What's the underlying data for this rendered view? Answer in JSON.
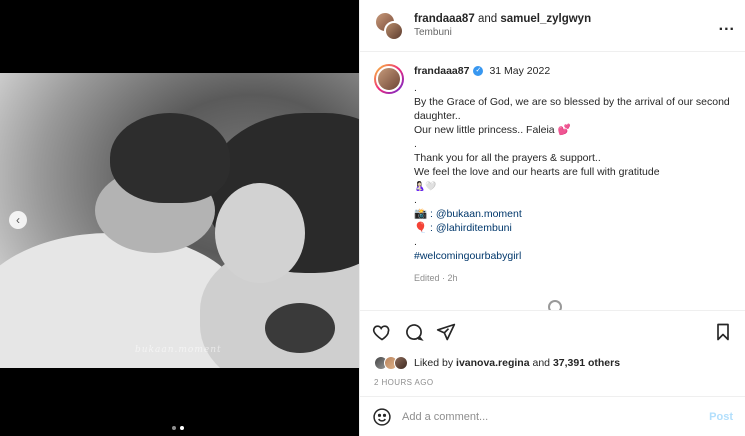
{
  "header": {
    "user1": "frandaaa87",
    "joiner": "and",
    "user2": "samuel_zylgwyn",
    "location": "Tembuni",
    "more_label": "..."
  },
  "media": {
    "watermark": "bukaan.moment",
    "prev_label": "‹",
    "slide_count": 2,
    "active_slide": 2
  },
  "caption": {
    "username": "frandaaa87",
    "date": "31 May 2022",
    "lines": [
      ".",
      "By the Grace of God, we are so blessed by the arrival of our second daughter..",
      "Our new little princess.. Faleia 💕",
      ".",
      "Thank you for all the prayers & support..",
      "We feel the love and our hearts are full with gratitude",
      "🤱🏻🤍",
      ".",
      "📸 : @bukaan.moment",
      "🎈 : @lahirditembuni",
      ".",
      "#welcomingourbabygirl"
    ],
    "edited": "Edited · 2h"
  },
  "likes": {
    "prefix": "Liked by",
    "user": "ivanova.regina",
    "joiner": "and",
    "others": "37,391 others"
  },
  "time_ago": "2 HOURS AGO",
  "comment": {
    "placeholder": "Add a comment...",
    "post_label": "Post"
  },
  "colors": {
    "link": "#00376b",
    "verified": "#3897f0",
    "post_disabled": "#b2dffc"
  }
}
